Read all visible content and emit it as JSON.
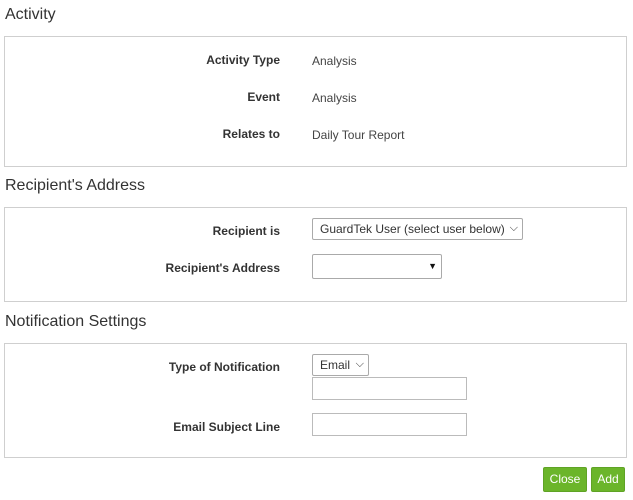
{
  "activity": {
    "title": "Activity",
    "fields": [
      {
        "label": "Activity Type",
        "value": "Analysis"
      },
      {
        "label": "Event",
        "value": "Analysis"
      },
      {
        "label": "Relates to",
        "value": "Daily Tour Report"
      }
    ]
  },
  "recipient": {
    "title": "Recipient's Address",
    "recipient_is_label": "Recipient is",
    "recipient_is_value": "GuardTek User (select user below)",
    "address_label": "Recipient's Address",
    "address_value": ""
  },
  "notification": {
    "title": "Notification Settings",
    "type_label": "Type of Notification",
    "type_value": "Email",
    "email_address_value": "",
    "subject_label": "Email Subject Line",
    "subject_value": ""
  },
  "footer": {
    "close_label": "Close",
    "add_label": "Add"
  },
  "colors": {
    "button_green": "#6bb52a",
    "panel_border": "#cfcfcf"
  },
  "icons": {
    "chevron": "chevron-down-icon",
    "caret": "caret-down-icon"
  }
}
